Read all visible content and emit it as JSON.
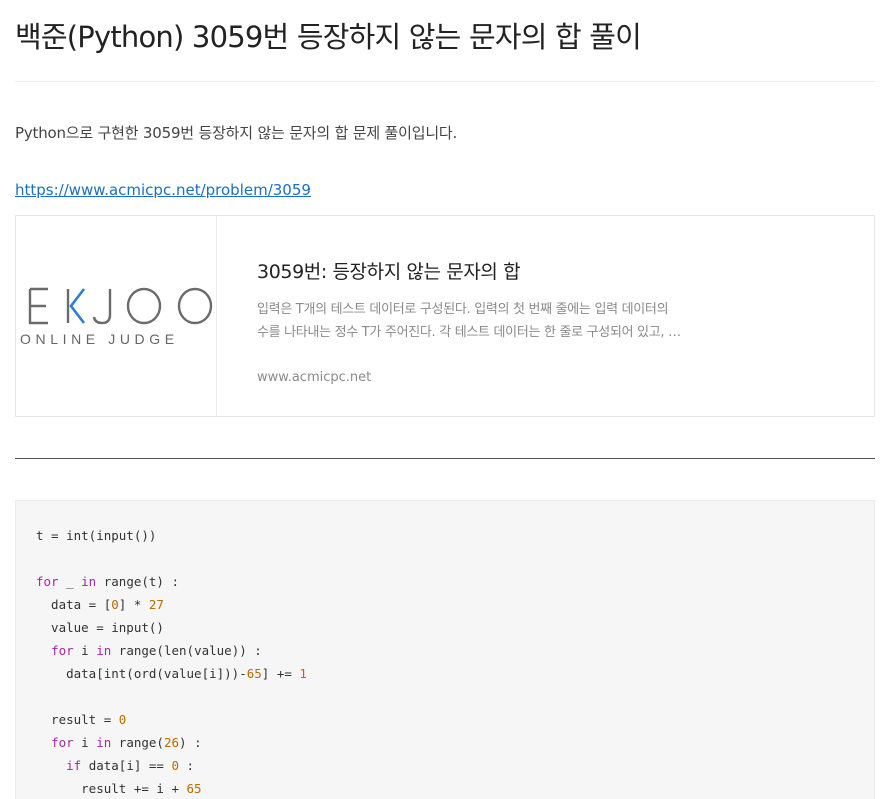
{
  "post": {
    "title": "백준(Python) 3059번 등장하지 않는 문자의 합 풀이",
    "intro": "Python으로 구현한 3059번 등장하지 않는 문자의 합 문제 풀이입니다.",
    "link": "https://www.acmicpc.net/problem/3059"
  },
  "og_card": {
    "logo_text": "BAEKJOON",
    "logo_sub": "ONLINE JUDGE",
    "title": "3059번: 등장하지 않는 문자의 합",
    "desc_line1": "입력은 T개의 테스트 데이터로 구성된다. 입력의 첫 번째 줄에는 입력 데이터의",
    "desc_line2": "수를 나타내는 정수 T가 주어진다. 각 테스트 데이터는 한 줄로 구성되어 있고, …",
    "domain": "www.acmicpc.net"
  },
  "code": [
    [
      [
        "t = int(input())",
        "op"
      ]
    ],
    [],
    [
      [
        "for",
        "kw"
      ],
      [
        " _ ",
        "op"
      ],
      [
        "in",
        "kw"
      ],
      [
        " range(t) :",
        "op"
      ]
    ],
    [
      [
        "  data = [",
        "op"
      ],
      [
        "0",
        "num"
      ],
      [
        "] * ",
        "op"
      ],
      [
        "27",
        "num"
      ]
    ],
    [
      [
        "  value = input()",
        "op"
      ]
    ],
    [
      [
        "  ",
        "op"
      ],
      [
        "for",
        "kw"
      ],
      [
        " i ",
        "op"
      ],
      [
        "in",
        "kw"
      ],
      [
        " range(len(value)) :",
        "op"
      ]
    ],
    [
      [
        "    data[int(ord(value[i]))-",
        "op"
      ],
      [
        "65",
        "num"
      ],
      [
        "] += ",
        "op"
      ],
      [
        "1",
        "num"
      ]
    ],
    [],
    [
      [
        "  result = ",
        "op"
      ],
      [
        "0",
        "num"
      ]
    ],
    [
      [
        "  ",
        "op"
      ],
      [
        "for",
        "kw"
      ],
      [
        " i ",
        "op"
      ],
      [
        "in",
        "kw"
      ],
      [
        " range(",
        "op"
      ],
      [
        "26",
        "num"
      ],
      [
        ") :",
        "op"
      ]
    ],
    [
      [
        "    ",
        "op"
      ],
      [
        "if",
        "kw"
      ],
      [
        " data[i] == ",
        "op"
      ],
      [
        "0",
        "num"
      ],
      [
        " :",
        "op"
      ]
    ],
    [
      [
        "      result += i + ",
        "op"
      ],
      [
        "65",
        "num"
      ]
    ]
  ]
}
